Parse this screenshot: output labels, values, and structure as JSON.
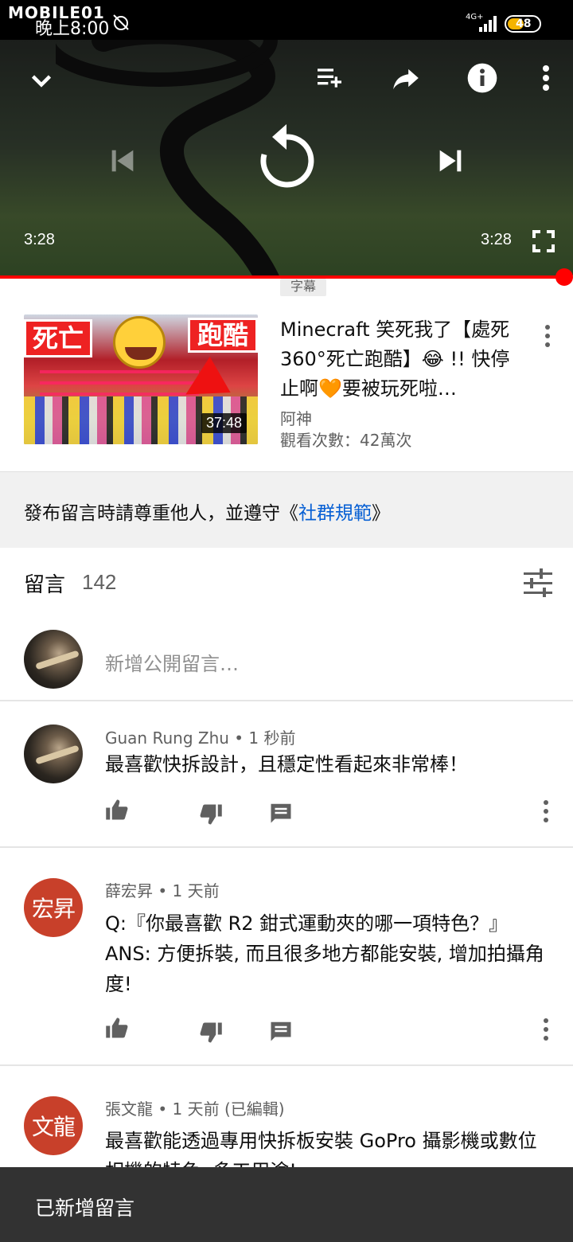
{
  "status_bar": {
    "watermark": "MOBILE01",
    "time": "晚上8:00",
    "network": "4G+",
    "battery": "48"
  },
  "player": {
    "elapsed": "3:28",
    "duration": "3:28",
    "progress": 1.0,
    "captions_label": "字幕",
    "icons": [
      "chevron-down-icon",
      "add-to-queue-icon",
      "share-icon",
      "info-icon",
      "more-vert-icon",
      "previous-icon",
      "replay-icon",
      "next-icon",
      "fullscreen-icon"
    ]
  },
  "up_next": {
    "title": "Minecraft 笑死我了【處死360°死亡跑酷】😂 !! 快停止啊🧡要被玩死啦…",
    "channel": "阿神",
    "views": "觀看次數：42萬次",
    "duration": "37:48",
    "thumb_text_left": "死亡",
    "thumb_text_right": "跑酷"
  },
  "guidelines": {
    "prefix": "發布留言時請尊重他人，並遵守《",
    "link": "社群規範",
    "suffix": "》"
  },
  "comments": {
    "title": "留言",
    "count": "142",
    "add_placeholder": "新增公開留言…",
    "items": [
      {
        "author": "Guan Rung Zhu",
        "time": "1 秒前",
        "meta": "Guan Rung Zhu • 1 秒前",
        "text": "最喜歡快拆設計，且穩定性看起來非常棒！",
        "avatar_text": ""
      },
      {
        "author": "薛宏昇",
        "time": "1 天前",
        "meta": "薛宏昇 • 1 天前",
        "text": "Q:『你最喜歡 R2 鉗式運動夾的哪一項特色？』ANS: 方便拆裝, 而且很多地方都能安裝, 增加拍攝角度!",
        "avatar_text": "宏昇"
      },
      {
        "author": "張文龍",
        "time": "1 天前 (已編輯)",
        "meta": "張文龍 • 1 天前 (已編輯)",
        "text": "最喜歡能透過專用快拆板安裝 GoPro 攝影機或數位相機的特色, 多工用途!",
        "avatar_text": "文龍"
      }
    ]
  },
  "snackbar": {
    "message": "已新增留言"
  },
  "colors": {
    "accent_red": "#ff0000",
    "link_blue": "#065fd4",
    "avatar_red": "#c8402a"
  }
}
